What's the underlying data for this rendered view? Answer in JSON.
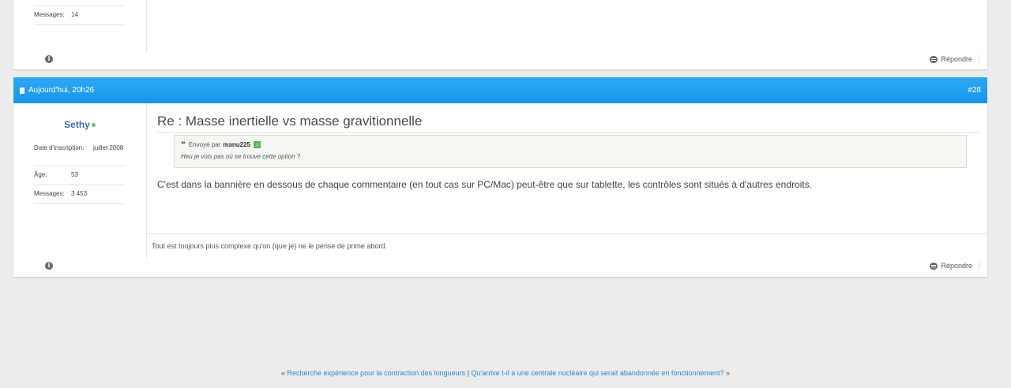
{
  "prev_post": {
    "messages_label": "Messages:",
    "messages_value": "14",
    "reply_label": "Répondre",
    "info_icon": "info-icon"
  },
  "post": {
    "date": "Aujourd'hui, 20h26",
    "number": "#28",
    "username": "Sethy",
    "online": true,
    "info": [
      {
        "label": "Date d'inscription:",
        "value": "juillet 2008"
      },
      {
        "label": "Âge:",
        "value": "53"
      },
      {
        "label": "Messages:",
        "value": "3 453"
      }
    ],
    "title": "Re : Masse inertielle vs masse gravitionnelle",
    "quote": {
      "sent_by": "Envoyé par",
      "author": "manu225",
      "text": "Heu je vois pas où se trouve cette option ?"
    },
    "message": "C'est dans la bannière en dessous de chaque commentaire (en tout cas sur PC/Mac) peut-être que sur tablette, les contrôles sont situés à d'autres endroits.",
    "signature": "Tout est toujours plus complexe qu'on (que je) ne le pense de prime abord.",
    "reply_label": "Répondre"
  },
  "footer_nav": {
    "prev_marker": "«",
    "prev_link": "Recherche expérience pour la contraction des longueurs",
    "separator": "|",
    "next_link": "Qu'arrive t-il a une centrale nucléaire qui serait abandonnée en fonctionnement?",
    "next_marker": "»"
  },
  "colors": {
    "header_bar": "#1f9ff0",
    "username": "#3b6fa8",
    "link": "#2a87c8",
    "online": "#6cc070"
  }
}
